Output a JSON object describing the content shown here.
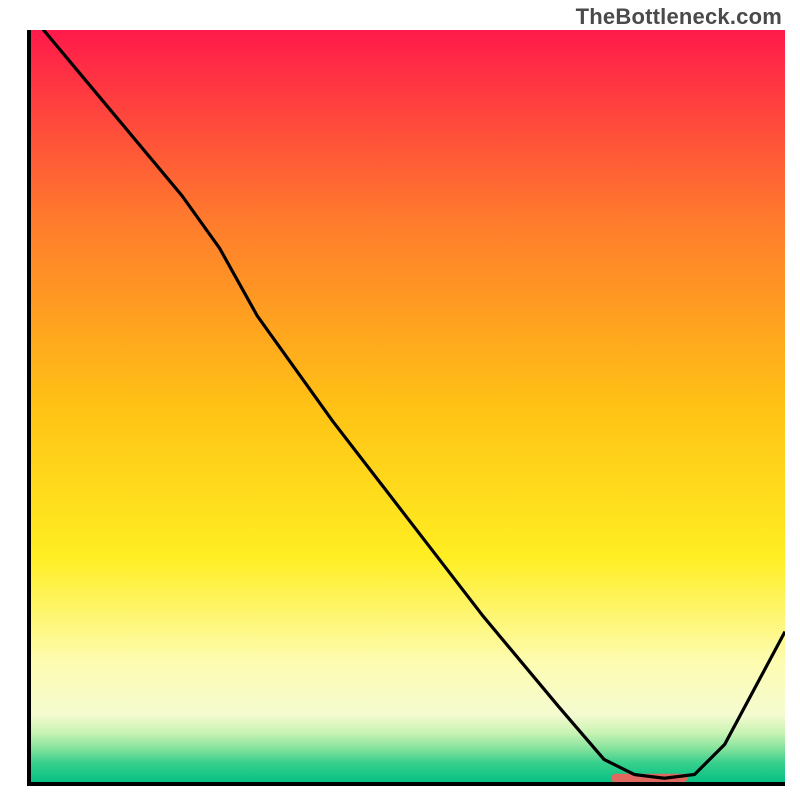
{
  "watermark": "TheBottleneck.com",
  "chart_data": {
    "type": "line",
    "title": "",
    "xlabel": "",
    "ylabel": "",
    "xlim": [
      0,
      100
    ],
    "ylim": [
      0,
      100
    ],
    "gradient_bands": [
      {
        "stop": 0.0,
        "color": "#ff1a4b"
      },
      {
        "stop": 0.25,
        "color": "#ff7a2d"
      },
      {
        "stop": 0.5,
        "color": "#ffc215"
      },
      {
        "stop": 0.7,
        "color": "#ffee22"
      },
      {
        "stop": 0.84,
        "color": "#fdfcb0"
      },
      {
        "stop": 0.91,
        "color": "#f5fbd0"
      },
      {
        "stop": 0.935,
        "color": "#c8f3b3"
      },
      {
        "stop": 0.955,
        "color": "#86e39d"
      },
      {
        "stop": 0.975,
        "color": "#36cf8c"
      },
      {
        "stop": 1.0,
        "color": "#06c184"
      }
    ],
    "series": [
      {
        "name": "bottleneck-curve",
        "stroke": "#000000",
        "x": [
          0,
          10,
          20,
          25,
          30,
          40,
          50,
          60,
          70,
          76,
          80,
          84,
          88,
          92,
          100
        ],
        "y": [
          102,
          90,
          78,
          71,
          62,
          48,
          35,
          22,
          10,
          3,
          1,
          0.5,
          1,
          5,
          20
        ]
      }
    ],
    "marker": {
      "name": "optimal-range",
      "color": "#e0685e",
      "x_start": 77,
      "x_end": 87,
      "y": 0.5,
      "thickness_pct": 1.2
    }
  }
}
